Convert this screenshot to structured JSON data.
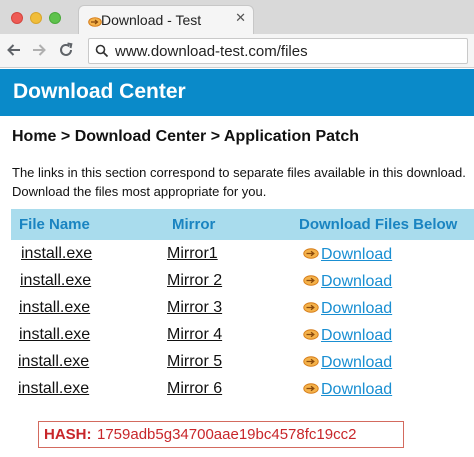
{
  "browser": {
    "tab_title": "Download - Test",
    "tab_close": "✕",
    "url": "www.download-test.com/files"
  },
  "page": {
    "header_title": "Download Center",
    "breadcrumb": "Home > Download Center > Application Patch",
    "intro": "The links in this section correspond to separate files available in this download. Download the files most appropriate for you.",
    "table": {
      "columns": [
        "File Name",
        "Mirror",
        "Download Files Below"
      ],
      "rows": [
        {
          "file": "install.exe",
          "mirror": "Mirror1",
          "download": "Download"
        },
        {
          "file": "install.exe",
          "mirror": "Mirror 2",
          "download": "Download"
        },
        {
          "file": "install.exe",
          "mirror": "Mirror 3",
          "download": "Download"
        },
        {
          "file": "install.exe",
          "mirror": "Mirror 4",
          "download": "Download"
        },
        {
          "file": "install.exe",
          "mirror": "Mirror 5",
          "download": "Download"
        },
        {
          "file": "install.exe",
          "mirror": "Mirror 6",
          "download": "Download"
        }
      ]
    },
    "hash": {
      "label": "HASH:",
      "value": "1759adb5g34700aae19bc4578fc19cc2"
    }
  },
  "colors": {
    "header_bg": "#0a8ac9",
    "table_header_bg": "#a9dced",
    "link": "#1a8fd2",
    "hash_red": "#c8262a"
  },
  "icons": [
    "favicon-icon",
    "close-icon",
    "back-arrow-icon",
    "forward-arrow-icon",
    "reload-icon",
    "search-icon",
    "download-icon"
  ]
}
